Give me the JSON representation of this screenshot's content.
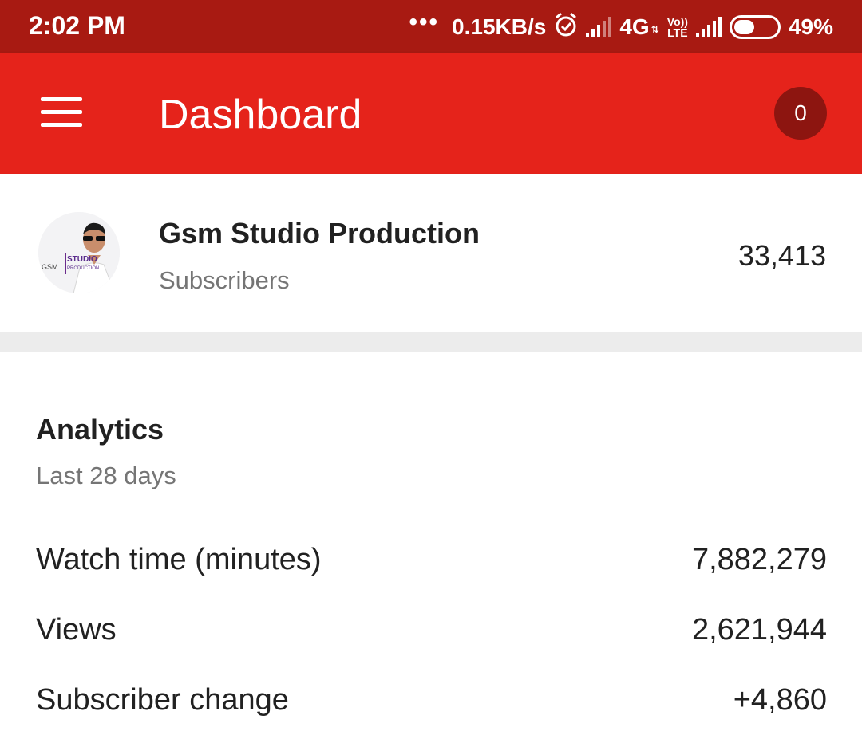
{
  "status_bar": {
    "time": "2:02 PM",
    "dots": "•••",
    "data_speed": "0.15KB/s",
    "network_type": "4G",
    "volte_top": "Vo))",
    "volte_bottom": "LTE",
    "battery_percent": "49%",
    "battery_level": 0.49,
    "icons": [
      "more-dots-icon",
      "alarm-icon",
      "signal-icon",
      "volte-icon",
      "battery-icon"
    ]
  },
  "app_bar": {
    "title": "Dashboard",
    "notification_count": "0",
    "background_color": "#e5231b",
    "icons": [
      "menu-icon"
    ]
  },
  "channel": {
    "name": "Gsm Studio Production",
    "subscribers_label": "Subscribers",
    "subscribers_count": "33,413",
    "avatar_text_gsm": "GSM",
    "avatar_text_studio": "STUDIO",
    "avatar_text_production": "PRODUCTION"
  },
  "analytics": {
    "title": "Analytics",
    "period": "Last 28 days",
    "metrics": [
      {
        "label": "Watch time (minutes)",
        "value": "7,882,279"
      },
      {
        "label": "Views",
        "value": "2,621,944"
      },
      {
        "label": "Subscriber change",
        "value": "+4,860"
      }
    ]
  }
}
